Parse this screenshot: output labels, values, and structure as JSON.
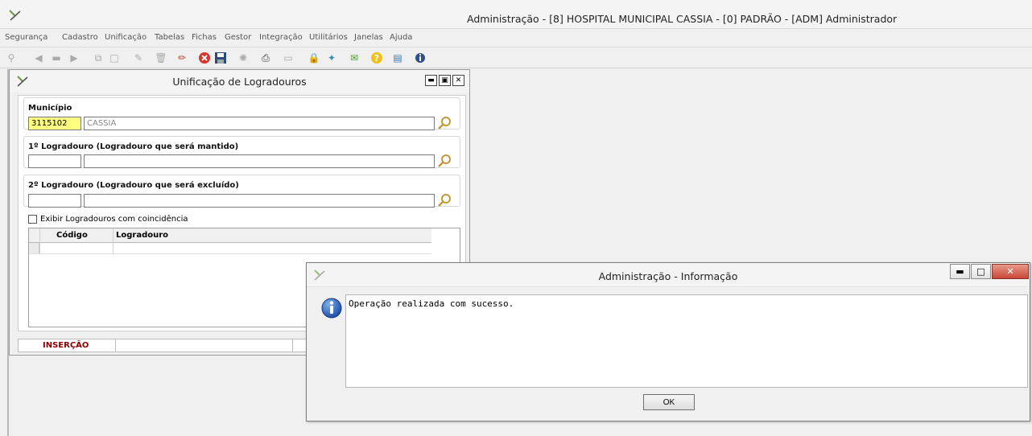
{
  "app": {
    "title": "Administração - [8] HOSPITAL MUNICIPAL  CASSIA - [0] PADRÃO - [ADM] Administrador"
  },
  "menu": [
    "Segurança",
    "Cadastro",
    "Unificação",
    "Tabelas",
    "Fichas",
    "Gestor",
    "Integração",
    "Utilitários",
    "Janelas",
    "Ajuda"
  ],
  "child_window": {
    "title": "Unificação de Logradouros",
    "municipio": {
      "label": "Município",
      "code": "3115102",
      "name": "CASSIA"
    },
    "logradouro1": {
      "label": "1º Logradouro (Logradouro que será mantido)",
      "code": "",
      "name": ""
    },
    "logradouro2": {
      "label": "2º Logradouro (Logradouro que será excluído)",
      "code": "",
      "name": ""
    },
    "checkbox_label": "Exibir Logradouros com coincidência",
    "grid": {
      "columns": [
        "Código",
        "Logradouro"
      ]
    },
    "status": "INSERÇÃO"
  },
  "dialog": {
    "title": "Administração - Informação",
    "message": "Operação realizada com sucesso.",
    "ok_label": "OK"
  },
  "colors": {
    "status_text": "#8b0000",
    "highlight_field": "#ffff80",
    "close_button": "#c9473a"
  }
}
